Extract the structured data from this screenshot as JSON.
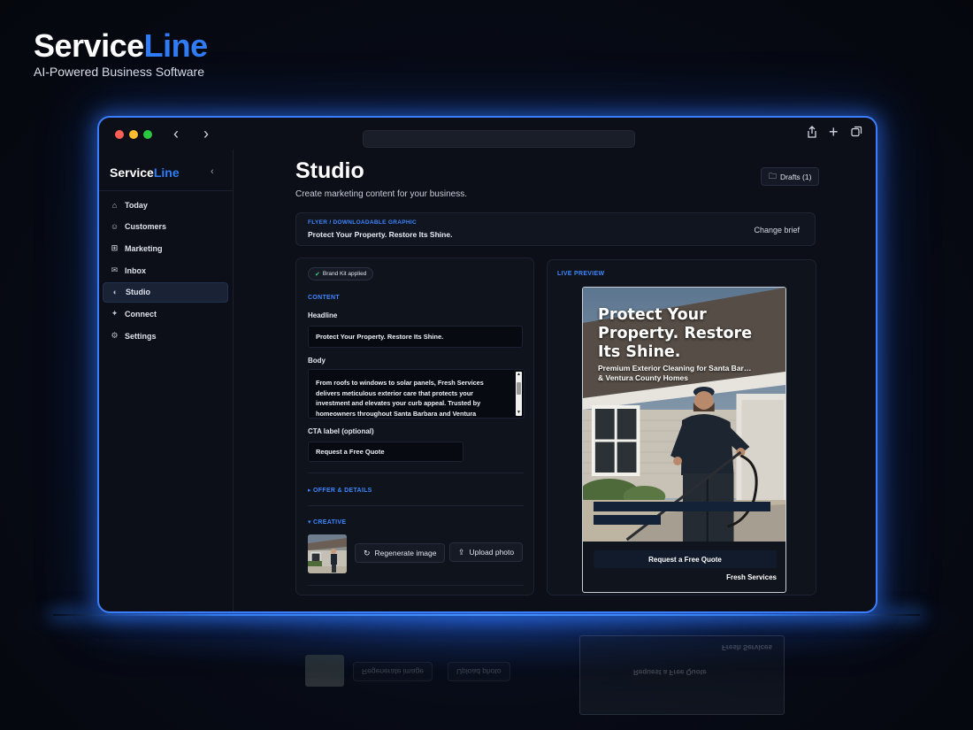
{
  "brand": {
    "name_part1": "Service",
    "name_part2": "Line",
    "tagline": "AI-Powered Business Software"
  },
  "app": {
    "logo_part1": "Service",
    "logo_part2": "Line",
    "sidebar": {
      "items": [
        {
          "label": "Today",
          "icon": "home-icon"
        },
        {
          "label": "Customers",
          "icon": "users-icon"
        },
        {
          "label": "Marketing",
          "icon": "grid-icon"
        },
        {
          "label": "Inbox",
          "icon": "inbox-icon"
        },
        {
          "label": "Studio",
          "icon": "palette-icon",
          "active": true
        },
        {
          "label": "Connect",
          "icon": "plug-icon"
        },
        {
          "label": "Settings",
          "icon": "gear-icon"
        }
      ]
    },
    "header": {
      "title": "Studio",
      "subtitle": "Create marketing content for your business.",
      "drafts_label": "Drafts (1)"
    },
    "brief": {
      "kicker": "FLYER / DOWNLOADABLE GRAPHIC",
      "title": "Protect Your Property. Restore Its Shine.",
      "change_label": "Change brief"
    },
    "editor": {
      "badge": "Brand Kit applied",
      "content_label": "CONTENT",
      "headline_label": "Headline",
      "headline_value": "Protect Your Property. Restore Its Shine.",
      "body_label": "Body",
      "body_value": "From roofs to windows to solar panels, Fresh Services delivers meticulous exterior care that protects your investment and elevates your curb appeal. Trusted by homeowners throughout Santa Barbara and Ventura",
      "cta_label": "CTA label (optional)",
      "cta_value": "Request a Free Quote",
      "offer_section": "▸ OFFER & DETAILS",
      "creative_section": "▾ CREATIVE",
      "regenerate_label": "Regenerate image",
      "upload_label": "Upload photo"
    },
    "preview": {
      "label": "LIVE PREVIEW",
      "headline": "Protect Your Property. Restore Its Shine.",
      "subheadline": "Premium Exterior Cleaning for Santa Bar…\n& Ventura County Homes",
      "cta": "Request a Free Quote",
      "business": "Fresh Services"
    }
  },
  "colors": {
    "accent": "#2f7cf6",
    "window_border": "#3b7dff",
    "background": "#070b16"
  }
}
